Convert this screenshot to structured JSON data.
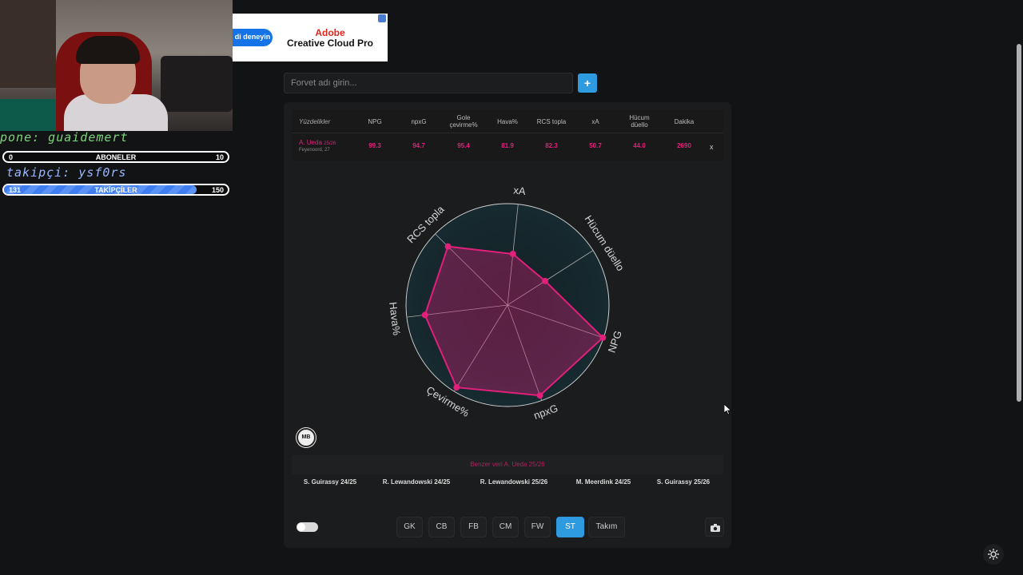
{
  "stream": {
    "overlay_line1": "pone: guaidemert",
    "overlay_line2": "takipçi: ysf0rs",
    "subs_bar": {
      "left": "0",
      "label": "ABONELER",
      "right": "10"
    },
    "followers_bar": {
      "left": "131",
      "label": "TAKİPÇİLER",
      "right": "150",
      "progress": 0.87
    }
  },
  "ad": {
    "pill": "di deneyin",
    "brand_line1": "Adobe",
    "brand_line2": "Creative Cloud Pro"
  },
  "search": {
    "placeholder": "Forvet adı girin...",
    "add_label": "+"
  },
  "table": {
    "headers": [
      "Yüzdelikler",
      "NPG",
      "npxG",
      "Gole çevirme%",
      "Hava%",
      "RCS topla",
      "xA",
      "Hücum düello",
      "Dakika"
    ],
    "player": {
      "name": "A. Ueda",
      "season": "25/26",
      "club": "Feyenoord, 27",
      "remove": "x"
    },
    "values": [
      "99.3",
      "94.7",
      "95.4",
      "81.9",
      "82.3",
      "50.7",
      "44.0",
      "2690"
    ]
  },
  "radar": {
    "labels": [
      "xA",
      "Hücum düello",
      "NPG",
      "npxG",
      "Çevirme%",
      "Hava%",
      "RCS topla"
    ],
    "values": [
      50.7,
      44.0,
      99.3,
      94.7,
      95.4,
      81.9,
      82.3
    ],
    "color": "#e0207a"
  },
  "logo": "MB",
  "similar": {
    "title": "Benzer veri A. Ueda 25/26",
    "items": [
      "S. Guirassy 24/25",
      "R. Lewandowski 24/25",
      "R. Lewandowski 25/26",
      "M. Meerdink 24/25",
      "S. Guirassy 25/26"
    ]
  },
  "positions": [
    "GK",
    "CB",
    "FB",
    "CM",
    "FW",
    "ST",
    "Takım"
  ],
  "active_position": "ST",
  "colors": {
    "accent": "#2e9ae0",
    "player": "#e0207a",
    "background": "#121314"
  }
}
